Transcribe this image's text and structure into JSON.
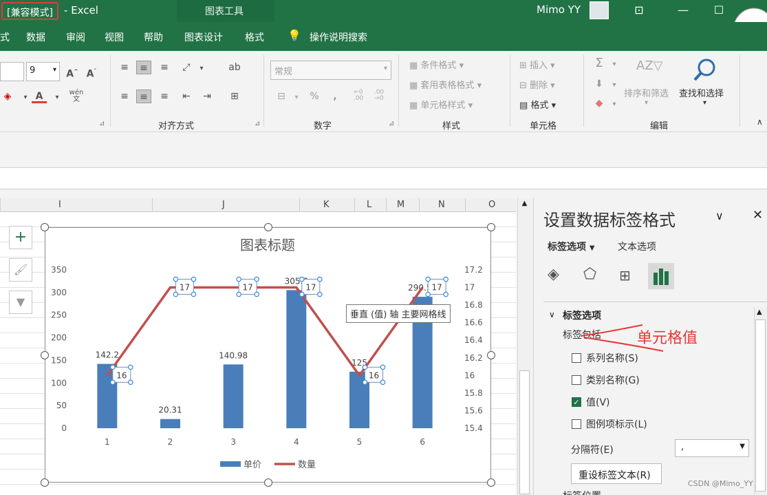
{
  "titlebar": {
    "compat_mode": "[兼容模式]",
    "separator": "-",
    "app": "Excel",
    "context_tools": "图表工具",
    "user": "Mimo YY"
  },
  "tabs": [
    "式",
    "数据",
    "审阅",
    "视图",
    "帮助",
    "图表设计",
    "格式",
    "操作说明搜索"
  ],
  "ribbon": {
    "font_size": "9",
    "font_group_a": "A",
    "wen": "wén\n文",
    "align_group_label": "对齐方式",
    "number_format": "常规",
    "number_group_label": "数字",
    "styles": {
      "conditional": "条件格式",
      "table": "套用表格格式",
      "cell": "单元格样式",
      "group_label": "样式"
    },
    "cells": {
      "insert": "插入",
      "delete": "删除",
      "format": "格式",
      "group_label": "单元格"
    },
    "edit": {
      "sort_filter": "排序和筛选",
      "find_select": "查找和选择",
      "group_label": "编辑"
    },
    "percent": "%",
    "comma": ","
  },
  "columns": [
    "I",
    "J",
    "K",
    "L",
    "M",
    "N",
    "O"
  ],
  "chart_data": {
    "type": "bar",
    "title": "图表标题",
    "categories": [
      "1",
      "2",
      "3",
      "4",
      "5",
      "6"
    ],
    "series": [
      {
        "name": "单价",
        "type": "bar",
        "axis": "left",
        "values": [
          142.2,
          20.31,
          140.98,
          305.3,
          125,
          290.51
        ],
        "color": "#4a7ebb"
      },
      {
        "name": "数量",
        "type": "line",
        "axis": "right",
        "values": [
          16,
          17,
          17,
          17,
          16,
          17
        ],
        "color": "#c0504d"
      }
    ],
    "bar_labels": [
      "142.2",
      "20.31",
      "140.98",
      "305.3",
      "125",
      "290.51"
    ],
    "line_labels": [
      "16",
      "17",
      "17",
      "17",
      "16",
      "17"
    ],
    "y_left": {
      "ylim": [
        0,
        350
      ],
      "ticks": [
        "0",
        "50",
        "100",
        "150",
        "200",
        "250",
        "300",
        "350"
      ]
    },
    "y_right": {
      "ylim": [
        15.4,
        17.2
      ],
      "ticks": [
        "15.4",
        "15.6",
        "15.8",
        "16",
        "16.2",
        "16.4",
        "16.6",
        "16.8",
        "17",
        "17.2"
      ]
    },
    "legend_position": "bottom",
    "grid": false
  },
  "chart_tooltip": "垂直 (值) 轴 主要网格线",
  "pane": {
    "title": "设置数据标签格式",
    "tab_label_options": "标签选项",
    "tab_text_options": "文本选项",
    "section": "标签选项",
    "contains": "标签包括",
    "annotation": "单元格值",
    "checkboxes": [
      {
        "label": "系列名称(S)",
        "checked": false
      },
      {
        "label": "类别名称(G)",
        "checked": false
      },
      {
        "label": "值(V)",
        "checked": true
      },
      {
        "label": "图例项标示(L)",
        "checked": false
      }
    ],
    "separator_label": "分隔符(E)",
    "separator_value": ",",
    "reset_button": "重设标签文本(R)",
    "cutoff_label": "标签位置"
  },
  "watermark": "CSDN @Mimo_YY",
  "colors": {
    "excel_green": "#217346",
    "bar_blue": "#4a7ebb",
    "line_red": "#c0504d",
    "annotation_red": "#e53935"
  }
}
